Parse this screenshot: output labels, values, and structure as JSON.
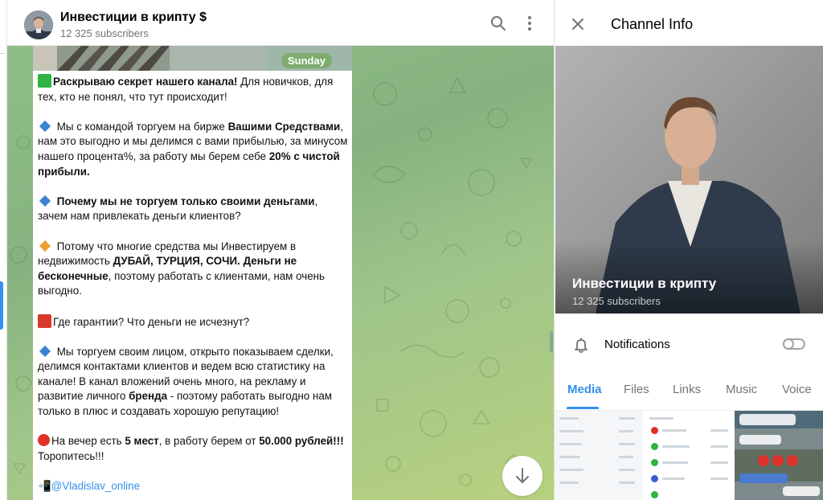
{
  "chat": {
    "title": "Инвестиции в крипту",
    "title_suffix": "$",
    "subscribers": "12 325 subscribers",
    "date_pill": "Sunday"
  },
  "message": {
    "p1": {
      "icon": "green-square",
      "bold": "Раскрываю секрет нашего канала!",
      "text": " Для новичков, для тех, кто не понял, что тут происходит!"
    },
    "p2": {
      "icon": "blue-diamond",
      "pre": " Мы с командой торгуем на бирже ",
      "b1": "Вашими Средствами",
      "mid": ", нам это выгодно и мы делимся с вами прибылью, за минусом нашего процента%, за работу мы берем себе ",
      "b2": "20% с чистой прибыли."
    },
    "p3": {
      "icon": "blue-diamond",
      "bold": " Почему мы не торгуем только своими деньгами",
      "text": ", зачем нам привлекать деньги клиентов?"
    },
    "p4": {
      "icon": "orange-diamond",
      "pre": " Потому что многие средства мы Инвестируем в недвижимость ",
      "b1": "ДУБАЙ, ТУРЦИЯ, СОЧИ. Деньги не бесконечные",
      "post": ", поэтому работать с клиентами, нам очень выгодно."
    },
    "p5": {
      "icon": "red-square",
      "text": "Где гарантии? Что деньги не исчезнут?"
    },
    "p6": {
      "icon": "blue-diamond",
      "pre": " Мы торгуем своим лицом, открыто показываем сделки, делимся контактами клиентов и ведем всю статистику на канале! В канал вложений очень много, на рекламу и развитие личного ",
      "b1": "бренда",
      "post": " - поэтому работать выгодно нам только в плюс и создавать хорошую репутацию!"
    },
    "p7": {
      "icon": "red-circle",
      "pre": "На вечер есть ",
      "b1": "5 мест",
      "mid": ", в работу берем от ",
      "b2": "50.000 рублей!!!",
      "post": " Торопитесь!!!"
    },
    "p8": {
      "icon": "phone-icon",
      "link": "@Vladislav_online"
    }
  },
  "info": {
    "title": "Channel Info",
    "name": "Инвестиции в крипту",
    "subscribers": "12 325 subscribers",
    "notifications_label": "Notifications",
    "notifications_on": false,
    "tabs": [
      "Media",
      "Files",
      "Links",
      "Music",
      "Voice"
    ],
    "active_tab": "Media"
  },
  "colors": {
    "accent": "#3390ec",
    "chat_bg": "#8fbf86",
    "green_square": "#2fb344",
    "blue_diamond": "#3b82d6",
    "orange_diamond": "#f0a030",
    "red_square": "#d9382c",
    "red_circle": "#e0302a"
  }
}
